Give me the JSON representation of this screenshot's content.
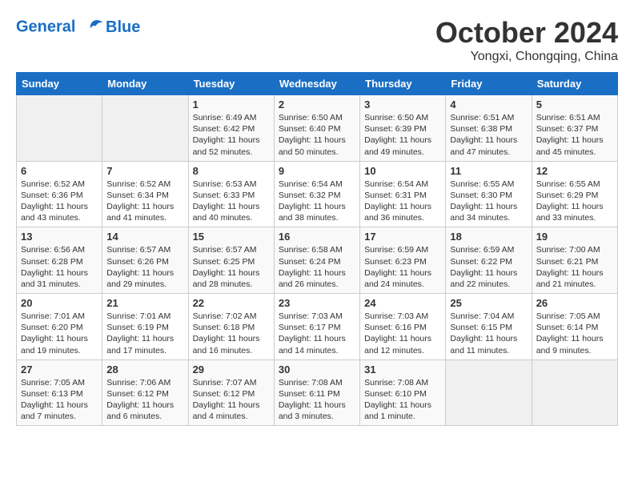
{
  "logo": {
    "line1": "General",
    "line2": "Blue"
  },
  "title": "October 2024",
  "location": "Yongxi, Chongqing, China",
  "days_of_week": [
    "Sunday",
    "Monday",
    "Tuesday",
    "Wednesday",
    "Thursday",
    "Friday",
    "Saturday"
  ],
  "weeks": [
    [
      {
        "num": "",
        "empty": true
      },
      {
        "num": "",
        "empty": true
      },
      {
        "num": "1",
        "sunrise": "Sunrise: 6:49 AM",
        "sunset": "Sunset: 6:42 PM",
        "daylight": "Daylight: 11 hours and 52 minutes."
      },
      {
        "num": "2",
        "sunrise": "Sunrise: 6:50 AM",
        "sunset": "Sunset: 6:40 PM",
        "daylight": "Daylight: 11 hours and 50 minutes."
      },
      {
        "num": "3",
        "sunrise": "Sunrise: 6:50 AM",
        "sunset": "Sunset: 6:39 PM",
        "daylight": "Daylight: 11 hours and 49 minutes."
      },
      {
        "num": "4",
        "sunrise": "Sunrise: 6:51 AM",
        "sunset": "Sunset: 6:38 PM",
        "daylight": "Daylight: 11 hours and 47 minutes."
      },
      {
        "num": "5",
        "sunrise": "Sunrise: 6:51 AM",
        "sunset": "Sunset: 6:37 PM",
        "daylight": "Daylight: 11 hours and 45 minutes."
      }
    ],
    [
      {
        "num": "6",
        "sunrise": "Sunrise: 6:52 AM",
        "sunset": "Sunset: 6:36 PM",
        "daylight": "Daylight: 11 hours and 43 minutes."
      },
      {
        "num": "7",
        "sunrise": "Sunrise: 6:52 AM",
        "sunset": "Sunset: 6:34 PM",
        "daylight": "Daylight: 11 hours and 41 minutes."
      },
      {
        "num": "8",
        "sunrise": "Sunrise: 6:53 AM",
        "sunset": "Sunset: 6:33 PM",
        "daylight": "Daylight: 11 hours and 40 minutes."
      },
      {
        "num": "9",
        "sunrise": "Sunrise: 6:54 AM",
        "sunset": "Sunset: 6:32 PM",
        "daylight": "Daylight: 11 hours and 38 minutes."
      },
      {
        "num": "10",
        "sunrise": "Sunrise: 6:54 AM",
        "sunset": "Sunset: 6:31 PM",
        "daylight": "Daylight: 11 hours and 36 minutes."
      },
      {
        "num": "11",
        "sunrise": "Sunrise: 6:55 AM",
        "sunset": "Sunset: 6:30 PM",
        "daylight": "Daylight: 11 hours and 34 minutes."
      },
      {
        "num": "12",
        "sunrise": "Sunrise: 6:55 AM",
        "sunset": "Sunset: 6:29 PM",
        "daylight": "Daylight: 11 hours and 33 minutes."
      }
    ],
    [
      {
        "num": "13",
        "sunrise": "Sunrise: 6:56 AM",
        "sunset": "Sunset: 6:28 PM",
        "daylight": "Daylight: 11 hours and 31 minutes."
      },
      {
        "num": "14",
        "sunrise": "Sunrise: 6:57 AM",
        "sunset": "Sunset: 6:26 PM",
        "daylight": "Daylight: 11 hours and 29 minutes."
      },
      {
        "num": "15",
        "sunrise": "Sunrise: 6:57 AM",
        "sunset": "Sunset: 6:25 PM",
        "daylight": "Daylight: 11 hours and 28 minutes."
      },
      {
        "num": "16",
        "sunrise": "Sunrise: 6:58 AM",
        "sunset": "Sunset: 6:24 PM",
        "daylight": "Daylight: 11 hours and 26 minutes."
      },
      {
        "num": "17",
        "sunrise": "Sunrise: 6:59 AM",
        "sunset": "Sunset: 6:23 PM",
        "daylight": "Daylight: 11 hours and 24 minutes."
      },
      {
        "num": "18",
        "sunrise": "Sunrise: 6:59 AM",
        "sunset": "Sunset: 6:22 PM",
        "daylight": "Daylight: 11 hours and 22 minutes."
      },
      {
        "num": "19",
        "sunrise": "Sunrise: 7:00 AM",
        "sunset": "Sunset: 6:21 PM",
        "daylight": "Daylight: 11 hours and 21 minutes."
      }
    ],
    [
      {
        "num": "20",
        "sunrise": "Sunrise: 7:01 AM",
        "sunset": "Sunset: 6:20 PM",
        "daylight": "Daylight: 11 hours and 19 minutes."
      },
      {
        "num": "21",
        "sunrise": "Sunrise: 7:01 AM",
        "sunset": "Sunset: 6:19 PM",
        "daylight": "Daylight: 11 hours and 17 minutes."
      },
      {
        "num": "22",
        "sunrise": "Sunrise: 7:02 AM",
        "sunset": "Sunset: 6:18 PM",
        "daylight": "Daylight: 11 hours and 16 minutes."
      },
      {
        "num": "23",
        "sunrise": "Sunrise: 7:03 AM",
        "sunset": "Sunset: 6:17 PM",
        "daylight": "Daylight: 11 hours and 14 minutes."
      },
      {
        "num": "24",
        "sunrise": "Sunrise: 7:03 AM",
        "sunset": "Sunset: 6:16 PM",
        "daylight": "Daylight: 11 hours and 12 minutes."
      },
      {
        "num": "25",
        "sunrise": "Sunrise: 7:04 AM",
        "sunset": "Sunset: 6:15 PM",
        "daylight": "Daylight: 11 hours and 11 minutes."
      },
      {
        "num": "26",
        "sunrise": "Sunrise: 7:05 AM",
        "sunset": "Sunset: 6:14 PM",
        "daylight": "Daylight: 11 hours and 9 minutes."
      }
    ],
    [
      {
        "num": "27",
        "sunrise": "Sunrise: 7:05 AM",
        "sunset": "Sunset: 6:13 PM",
        "daylight": "Daylight: 11 hours and 7 minutes."
      },
      {
        "num": "28",
        "sunrise": "Sunrise: 7:06 AM",
        "sunset": "Sunset: 6:12 PM",
        "daylight": "Daylight: 11 hours and 6 minutes."
      },
      {
        "num": "29",
        "sunrise": "Sunrise: 7:07 AM",
        "sunset": "Sunset: 6:12 PM",
        "daylight": "Daylight: 11 hours and 4 minutes."
      },
      {
        "num": "30",
        "sunrise": "Sunrise: 7:08 AM",
        "sunset": "Sunset: 6:11 PM",
        "daylight": "Daylight: 11 hours and 3 minutes."
      },
      {
        "num": "31",
        "sunrise": "Sunrise: 7:08 AM",
        "sunset": "Sunset: 6:10 PM",
        "daylight": "Daylight: 11 hours and 1 minute."
      },
      {
        "num": "",
        "empty": true
      },
      {
        "num": "",
        "empty": true
      }
    ]
  ]
}
